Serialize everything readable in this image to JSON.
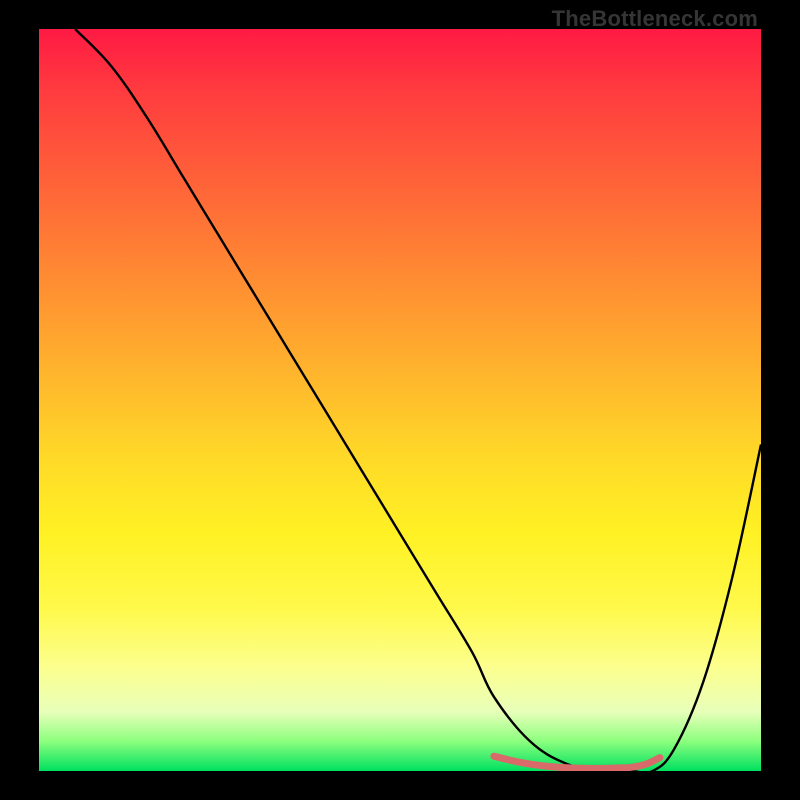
{
  "watermark": "TheBottleneck.com",
  "chart_data": {
    "type": "line",
    "title": "",
    "xlabel": "",
    "ylabel": "",
    "xlim": [
      0,
      100
    ],
    "ylim": [
      0,
      100
    ],
    "series": [
      {
        "name": "primary-curve",
        "color": "#000000",
        "x": [
          5,
          10,
          15,
          20,
          25,
          30,
          35,
          40,
          45,
          50,
          55,
          60,
          63,
          68,
          73,
          78,
          82,
          85,
          88,
          92,
          96,
          100
        ],
        "y": [
          100,
          95,
          88,
          80,
          72,
          64,
          56,
          48,
          40,
          32,
          24,
          16,
          10,
          4,
          1,
          0,
          0,
          0,
          3,
          12,
          26,
          44
        ]
      },
      {
        "name": "floor-segment",
        "color": "#d86a6a",
        "x": [
          63,
          66,
          69,
          72,
          74,
          76,
          78,
          80,
          82,
          84,
          86
        ],
        "y": [
          2.0,
          1.3,
          0.8,
          0.5,
          0.4,
          0.35,
          0.35,
          0.4,
          0.5,
          0.9,
          1.8
        ]
      }
    ],
    "gradient_stops": [
      {
        "pos": 0,
        "color": "#ff1a44"
      },
      {
        "pos": 50,
        "color": "#ffda28"
      },
      {
        "pos": 90,
        "color": "#fcff8e"
      },
      {
        "pos": 100,
        "color": "#00e060"
      }
    ]
  }
}
